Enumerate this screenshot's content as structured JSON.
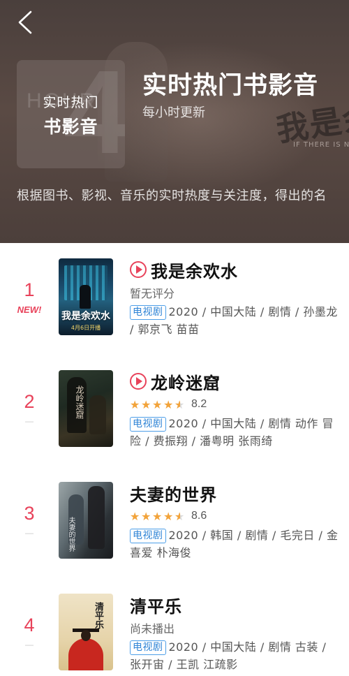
{
  "header": {
    "back_label": "返回",
    "badge_line1": "实时热门",
    "badge_line2": "书影音",
    "badge_watermark_4": "4",
    "badge_watermark_hour": "HOUR",
    "title": "实时热门书影音",
    "subtitle": "每小时更新",
    "description": "根据图书、影视、音乐的实时热度与关注度，得出的名",
    "bg_poster_title": "我是余",
    "bg_poster_sub": "IF THERE IS NO"
  },
  "items": [
    {
      "rank": "1",
      "trend": "NEW!",
      "has_play": true,
      "title": "我是余欢水",
      "rating_text": "暂无评分",
      "stars": 0,
      "score": "",
      "tag": "电视剧",
      "meta": "2020 / 中国大陆 / 剧情 / 孙墨龙 / 郭京飞 苗苗",
      "poster": {
        "title": "我是余欢水",
        "date": "4月6日开播"
      }
    },
    {
      "rank": "2",
      "trend": "—",
      "has_play": true,
      "title": "龙岭迷窟",
      "rating_text": "",
      "stars": 4.5,
      "score": "8.2",
      "tag": "电视剧",
      "meta": "2020 / 中国大陆 / 剧情 动作 冒险 / 费振翔 / 潘粤明 张雨绮",
      "poster": {
        "title": "龙岭迷窟",
        "date": ""
      }
    },
    {
      "rank": "3",
      "trend": "—",
      "has_play": false,
      "title": "夫妻的世界",
      "rating_text": "",
      "stars": 4.5,
      "score": "8.6",
      "tag": "电视剧",
      "meta": "2020 / 韩国 / 剧情 / 毛完日 / 金喜爱 朴海俊",
      "poster": {
        "title": "夫妻的世界",
        "date": ""
      }
    },
    {
      "rank": "4",
      "trend": "—",
      "has_play": false,
      "title": "清平乐",
      "rating_text": "尚未播出",
      "stars": 0,
      "score": "",
      "tag": "电视剧",
      "meta": "2020 / 中国大陆 / 剧情 古装 / 张开宙 / 王凯 江疏影",
      "poster": {
        "title": "清平乐",
        "date": ""
      }
    }
  ],
  "colors": {
    "accent_red": "#e8425a",
    "tag_blue": "#2f84d6",
    "star_orange": "#f2a33a",
    "header_bg": "#4a3f3c"
  }
}
